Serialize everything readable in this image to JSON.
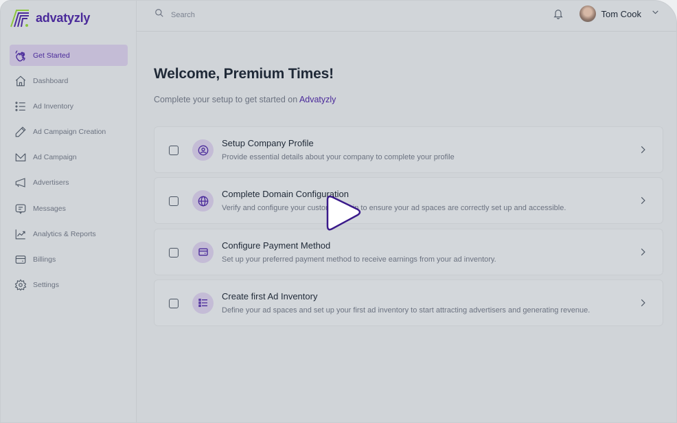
{
  "brand": {
    "name": "advatyzly",
    "accent": "#4a2a9a",
    "logo_green": "#8cc63f"
  },
  "sidebar": {
    "items": [
      {
        "label": "Get Started",
        "icon": "waving-hand-icon",
        "active": true
      },
      {
        "label": "Dashboard",
        "icon": "home-icon"
      },
      {
        "label": "Ad Inventory",
        "icon": "list-icon"
      },
      {
        "label": "Ad Campaign Creation",
        "icon": "pencil-icon"
      },
      {
        "label": "Ad Campaign",
        "icon": "envelope-icon"
      },
      {
        "label": "Advertisers",
        "icon": "megaphone-icon"
      },
      {
        "label": "Messages",
        "icon": "message-icon"
      },
      {
        "label": "Analytics & Reports",
        "icon": "chart-line-icon"
      },
      {
        "label": "Billings",
        "icon": "card-icon"
      },
      {
        "label": "Settings",
        "icon": "gear-icon"
      }
    ]
  },
  "topbar": {
    "search_placeholder": "Search",
    "user_name": "Tom Cook"
  },
  "main": {
    "title": "Welcome, Premium Times!",
    "subtitle_prefix": "Complete your setup to get started on ",
    "subtitle_brand": "Advatyzly"
  },
  "tasks": [
    {
      "title": "Setup Company Profile",
      "description": "Provide essential details about your company to complete your profile",
      "icon": "user-circle-icon",
      "checked": false
    },
    {
      "title": "Complete Domain Configuration",
      "description": "Verify and configure your custom domain to ensure your ad spaces are correctly set up and accessible.",
      "icon": "globe-icon",
      "checked": false
    },
    {
      "title": "Configure Payment Method",
      "description": "Set up your preferred payment method to receive earnings from your ad inventory.",
      "icon": "card-icon",
      "checked": false
    },
    {
      "title": "Create first Ad Inventory",
      "description": "Define your ad spaces and set up your first ad inventory to start attracting advertisers and generating revenue.",
      "icon": "list-icon",
      "checked": false
    }
  ],
  "overlay": {
    "icon": "play-icon"
  }
}
